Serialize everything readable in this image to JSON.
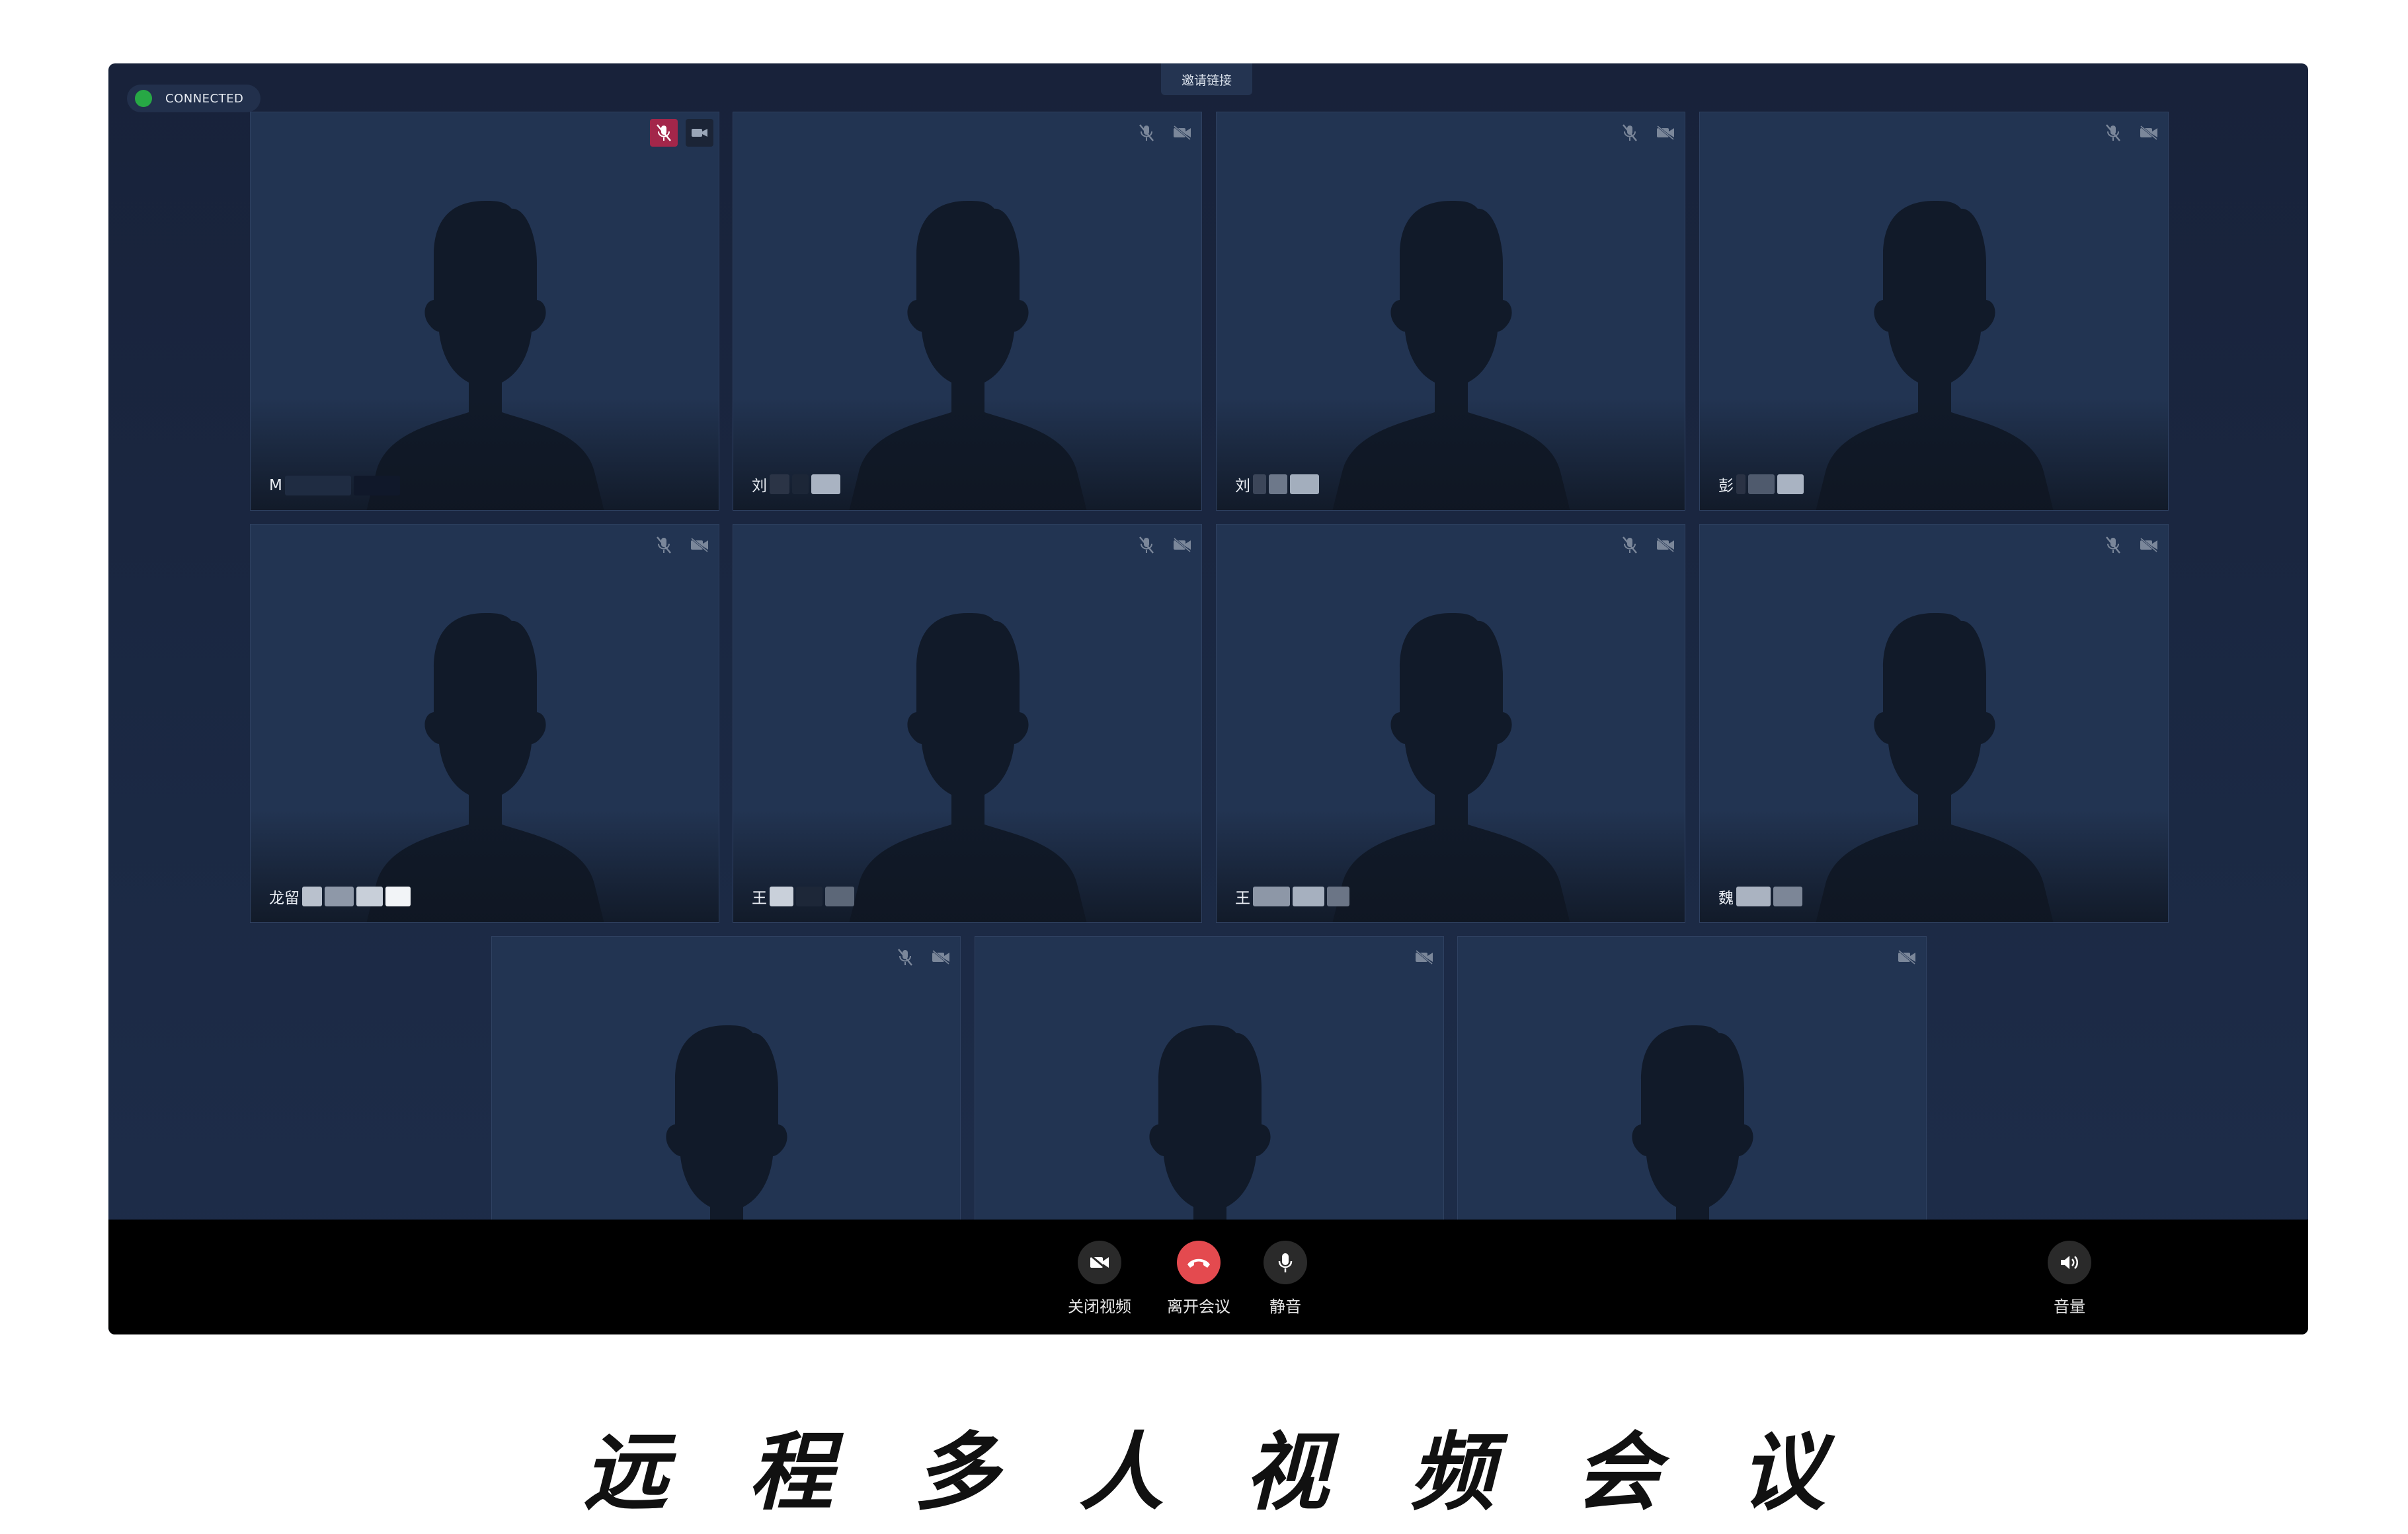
{
  "status": {
    "label": "CONNECTED",
    "color": "#27a845"
  },
  "invite_button": {
    "label": "邀请链接"
  },
  "participants": [
    {
      "name_prefix": "M",
      "mic_muted": true,
      "mic_highlight": true,
      "camera_on": true
    },
    {
      "name_prefix": "刘",
      "mic_muted": true,
      "camera_on": false
    },
    {
      "name_prefix": "刘",
      "mic_muted": true,
      "camera_on": false
    },
    {
      "name_prefix": "彭",
      "mic_muted": true,
      "camera_on": false
    },
    {
      "name_prefix": "龙留",
      "mic_muted": true,
      "camera_on": false
    },
    {
      "name_prefix": "王",
      "mic_muted": true,
      "camera_on": false
    },
    {
      "name_prefix": "王",
      "mic_muted": true,
      "camera_on": false
    },
    {
      "name_prefix": "魏",
      "mic_muted": true,
      "camera_on": false
    },
    {
      "name_prefix": "",
      "mic_muted": true,
      "camera_on": false
    },
    {
      "name_prefix": "",
      "mic_muted": false,
      "camera_on": false
    },
    {
      "name_prefix": "",
      "mic_muted": false,
      "camera_on": false
    }
  ],
  "toolbar": {
    "close_video_label": "关闭视频",
    "leave_meeting_label": "离开会议",
    "mute_label": "静音",
    "volume_label": "音量",
    "leave_color": "#e44a4f"
  },
  "caption": [
    "远",
    "程",
    "多",
    "人",
    "视",
    "频",
    "会",
    "议"
  ]
}
